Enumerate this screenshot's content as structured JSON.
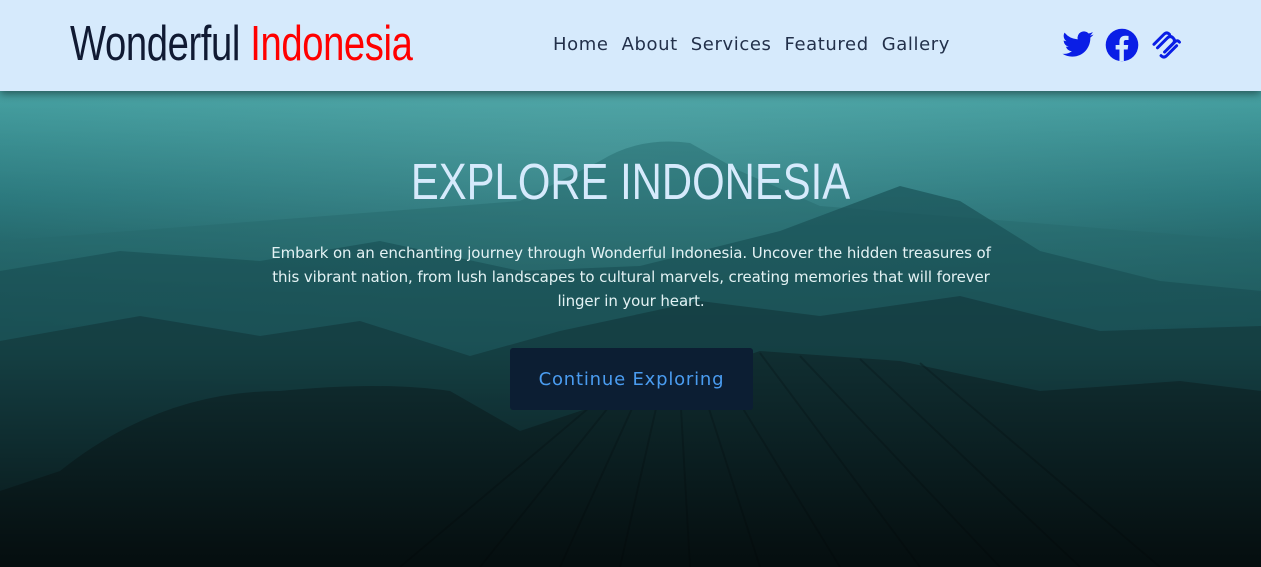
{
  "header": {
    "brand_first": "Wonderful",
    "brand_second": "Indonesia",
    "nav": [
      "Home",
      "About",
      "Services",
      "Featured",
      "Gallery"
    ],
    "social": [
      "twitter-icon",
      "facebook-icon",
      "squarespace-icon"
    ]
  },
  "hero": {
    "title": "EXPLORE INDONESIA",
    "text": "Embark on an enchanting journey through Wonderful Indonesia. Uncover the hidden treasures of this vibrant nation, from lush landscapes to cultural marvels, creating memories that will forever linger in your heart.",
    "button_label": "Continue Exploring"
  },
  "colors": {
    "header_bg": "#d6eafc",
    "brand_dark": "#101a33",
    "brand_accent": "#ff0000",
    "icon_blue": "#0a1ee6",
    "hero_title": "#d6eafc",
    "button_bg": "#0c1e33",
    "button_text": "#4a9cf0"
  }
}
